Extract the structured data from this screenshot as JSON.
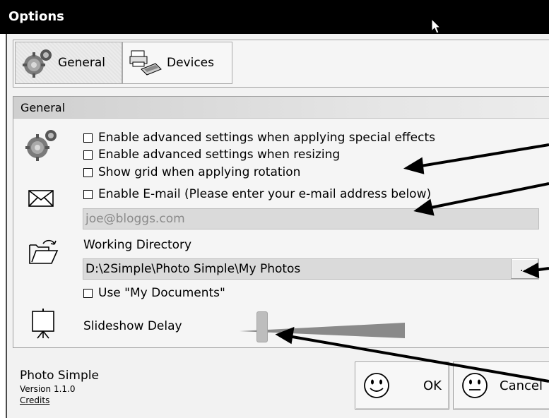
{
  "window": {
    "title": "Options"
  },
  "tabs": [
    {
      "label": "General",
      "icon": "gears-icon",
      "active": true
    },
    {
      "label": "Devices",
      "icon": "printer-scanner-icon",
      "active": false
    }
  ],
  "panel": {
    "header": "General",
    "options": [
      {
        "label": "Enable advanced settings when applying special effects",
        "checked": false
      },
      {
        "label": "Enable advanced settings when resizing",
        "checked": false
      },
      {
        "label": "Show grid when applying rotation",
        "checked": false
      }
    ],
    "email": {
      "checkbox_label": "Enable E-mail (Please enter your e-mail address below)",
      "checked": false,
      "value": "joe@bloggs.com"
    },
    "working_directory": {
      "label": "Working Directory",
      "value": "D:\\2Simple\\Photo Simple\\My Photos",
      "browse_label": "...",
      "use_my_documents_label": "Use \"My Documents\"",
      "use_my_documents_checked": false
    },
    "slideshow": {
      "label": "Slideshow Delay",
      "level": 0.13
    }
  },
  "footer": {
    "app_name": "Photo Simple",
    "version": "Version 1.1.0",
    "credits": "Credits"
  },
  "buttons": {
    "ok": "OK",
    "cancel": "Cancel"
  },
  "colors": {
    "titlebar": "#000000",
    "window_bg": "#f2f2f2",
    "field_bg": "#dadada"
  }
}
